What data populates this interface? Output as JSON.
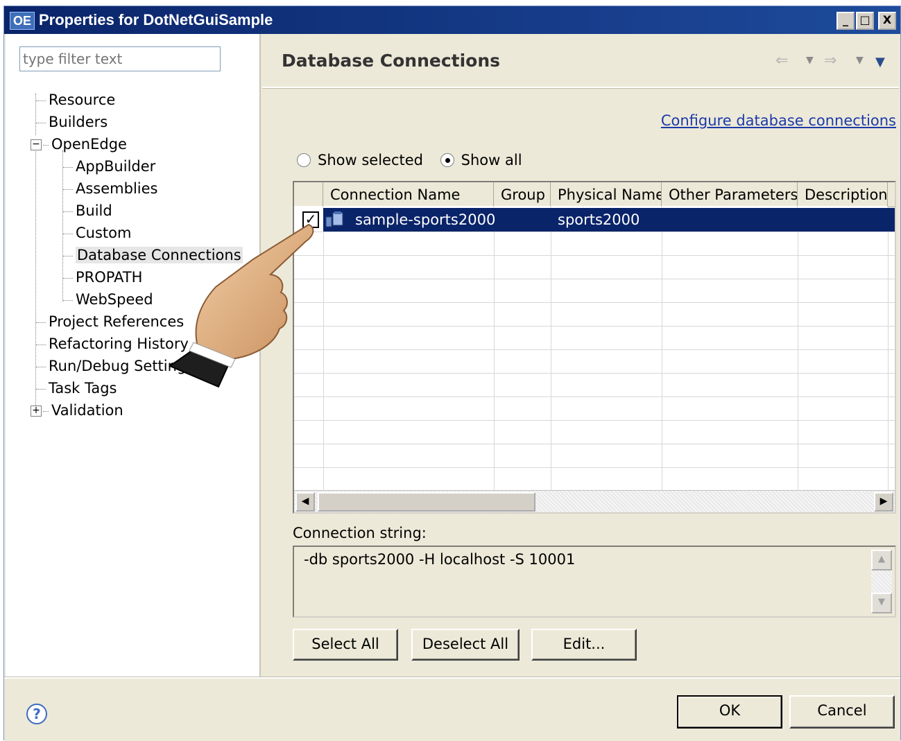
{
  "window": {
    "icon_label": "OE",
    "title": "Properties for DotNetGuiSample",
    "controls": {
      "minimize": "_",
      "maximize": "□",
      "close": "X"
    }
  },
  "sidebar": {
    "filter_placeholder": "type filter text",
    "items": [
      {
        "label": "Resource"
      },
      {
        "label": "Builders"
      },
      {
        "label": "OpenEdge",
        "expander": "−"
      },
      {
        "label": "AppBuilder"
      },
      {
        "label": "Assemblies"
      },
      {
        "label": "Build"
      },
      {
        "label": "Custom"
      },
      {
        "label": "Database Connections"
      },
      {
        "label": "PROPATH"
      },
      {
        "label": "WebSpeed"
      },
      {
        "label": "Project References"
      },
      {
        "label": "Refactoring History"
      },
      {
        "label": "Run/Debug Settings"
      },
      {
        "label": "Task Tags"
      },
      {
        "label": "Validation",
        "expander": "+"
      }
    ]
  },
  "page": {
    "title": "Database Connections",
    "configure_link": "Configure database connections",
    "radios": {
      "show_selected": "Show selected",
      "show_all": "Show all",
      "selected": "show_all"
    },
    "table": {
      "columns": [
        "Connection Name",
        "Group",
        "Physical Name",
        "Other Parameters",
        "Description"
      ],
      "rows": [
        {
          "checked": true,
          "connection_name": "sample-sports2000",
          "group": "",
          "physical_name": "sports2000",
          "other_parameters": "",
          "description": ""
        }
      ]
    },
    "connection_string_label": "Connection string:",
    "connection_string": "-db sports2000 -H localhost -S 10001",
    "buttons": {
      "select_all": "Select All",
      "deselect_all": "Deselect All",
      "edit": "Edit..."
    }
  },
  "footer": {
    "help": "?",
    "ok": "OK",
    "cancel": "Cancel"
  },
  "colors": {
    "title_bar": "#0a246a",
    "selection": "#0a246a",
    "link": "#1c3aa9",
    "dialog_bg": "#ece9d8"
  },
  "icons": [
    "help-icon",
    "database-connection-icon",
    "back-arrow-icon",
    "forward-arrow-icon",
    "view-menu-icon",
    "pointing-hand-icon"
  ]
}
